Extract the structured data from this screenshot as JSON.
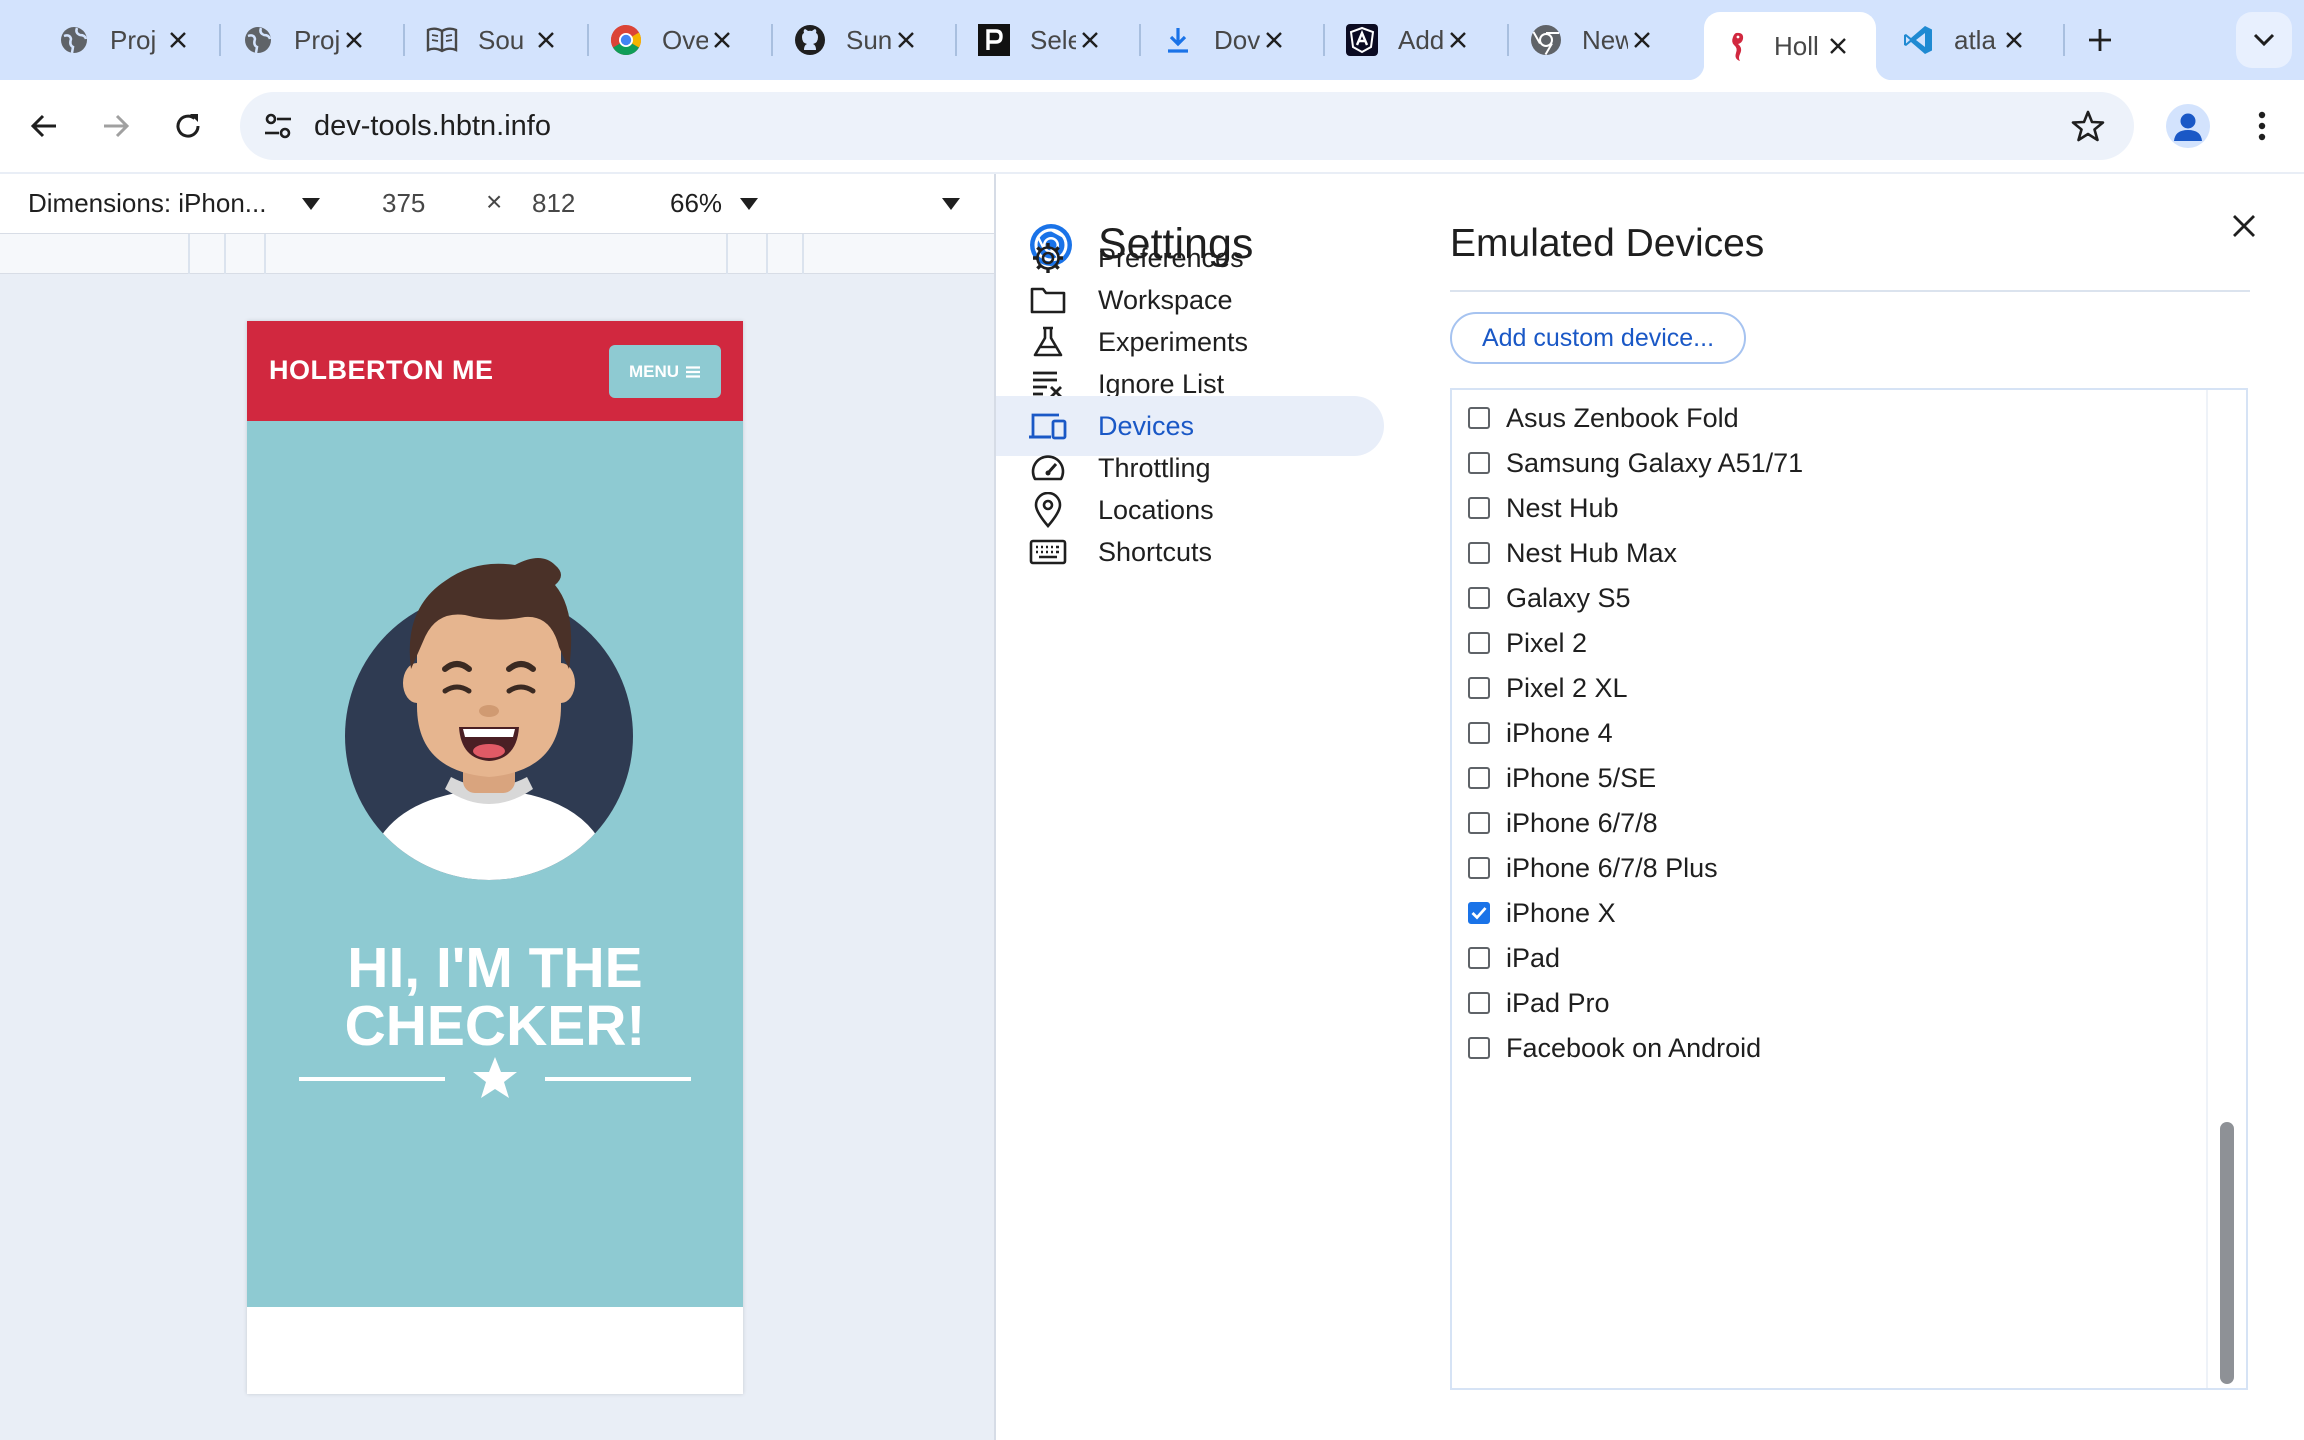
{
  "browser": {
    "tabs": [
      {
        "title": "Proj",
        "icon": "globe-icon"
      },
      {
        "title": "Proj",
        "icon": "globe-icon"
      },
      {
        "title": "Sou",
        "icon": "book-icon"
      },
      {
        "title": "Ove",
        "icon": "chrome-icon"
      },
      {
        "title": "Sun",
        "icon": "github-icon"
      },
      {
        "title": "Sele",
        "icon": "p-logo-icon"
      },
      {
        "title": "Dov",
        "icon": "download-icon"
      },
      {
        "title": "Add",
        "icon": "angular-icon"
      },
      {
        "title": "New",
        "icon": "chrome-gray-icon"
      },
      {
        "title": "Holl",
        "icon": "seahorse-icon",
        "active": true
      },
      {
        "title": "atla",
        "icon": "vscode-icon"
      }
    ],
    "url": "dev-tools.hbtn.info"
  },
  "device_toolbar": {
    "dimensions_label": "Dimensions: iPhon...",
    "width": "375",
    "times": "×",
    "height": "812",
    "zoom": "66%"
  },
  "page": {
    "brand": "HOLBERTON ME",
    "menu_label": "MENU",
    "hero_line1": "HI, I'M THE",
    "hero_line2": "CHECKER!"
  },
  "settings": {
    "title": "Settings",
    "nav": [
      {
        "label": "Preferences",
        "icon": "gear-icon"
      },
      {
        "label": "Workspace",
        "icon": "folder-icon"
      },
      {
        "label": "Experiments",
        "icon": "flask-icon"
      },
      {
        "label": "Ignore List",
        "icon": "ignore-list-icon"
      },
      {
        "label": "Devices",
        "icon": "devices-icon",
        "selected": true
      },
      {
        "label": "Throttling",
        "icon": "speedometer-icon"
      },
      {
        "label": "Locations",
        "icon": "location-pin-icon"
      },
      {
        "label": "Shortcuts",
        "icon": "keyboard-icon"
      }
    ],
    "pane_title": "Emulated Devices",
    "add_button": "Add custom device...",
    "devices": [
      {
        "name": "Asus Zenbook Fold",
        "checked": false
      },
      {
        "name": "Samsung Galaxy A51/71",
        "checked": false
      },
      {
        "name": "Nest Hub",
        "checked": false
      },
      {
        "name": "Nest Hub Max",
        "checked": false
      },
      {
        "name": "Galaxy S5",
        "checked": false
      },
      {
        "name": "Pixel 2",
        "checked": false
      },
      {
        "name": "Pixel 2 XL",
        "checked": false
      },
      {
        "name": "iPhone 4",
        "checked": false
      },
      {
        "name": "iPhone 5/SE",
        "checked": false
      },
      {
        "name": "iPhone 6/7/8",
        "checked": false
      },
      {
        "name": "iPhone 6/7/8 Plus",
        "checked": false
      },
      {
        "name": "iPhone X",
        "checked": true
      },
      {
        "name": "iPad",
        "checked": false
      },
      {
        "name": "iPad Pro",
        "checked": false
      },
      {
        "name": "Facebook on Android",
        "checked": false
      }
    ]
  },
  "colors": {
    "tabstrip": "#d3e3fd",
    "accent_blue": "#1a73e8",
    "site_red": "#d1283f",
    "site_teal": "#8ecad2",
    "avatar_navy": "#2f3b52"
  }
}
